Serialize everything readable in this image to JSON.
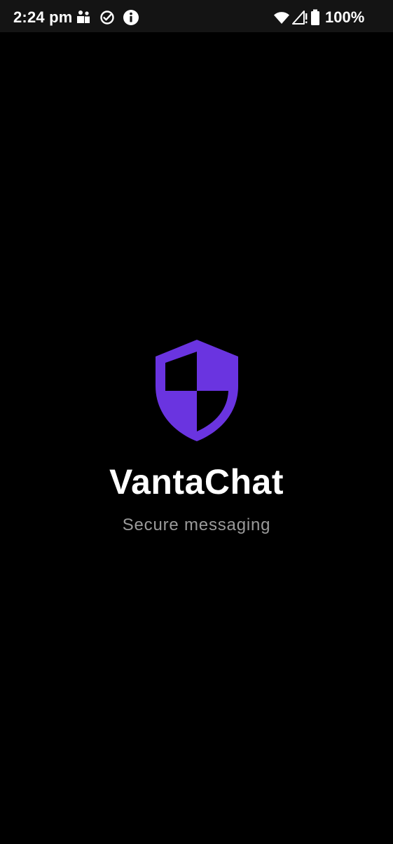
{
  "status_bar": {
    "time": "2:24 pm",
    "battery_percent": "100%",
    "left_icons": [
      "people-icon",
      "check-circle-icon",
      "info-icon"
    ],
    "right_icons": [
      "wifi-icon",
      "cell-signal-no-service-icon",
      "battery-icon"
    ]
  },
  "splash": {
    "logo_icon": "shield-icon",
    "app_name": "VantaChat",
    "tagline": "Secure messaging"
  },
  "colors": {
    "background": "#000000",
    "status_bar_bg": "#141414",
    "brand_accent": "#6a34e0",
    "title_text": "#ffffff",
    "tagline_text": "#9a9a9a"
  }
}
